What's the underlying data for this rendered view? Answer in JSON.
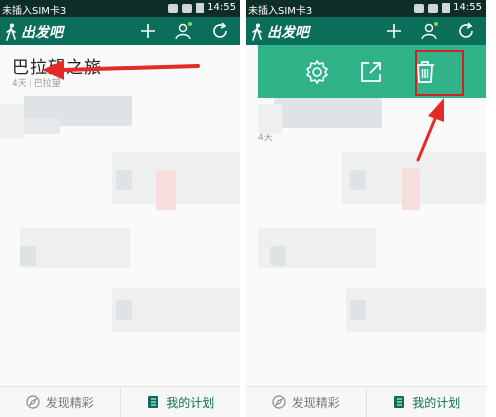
{
  "status_bar": {
    "carrier": "未插入SIM卡3",
    "time": "14:55"
  },
  "app": {
    "logo_text": "出发吧",
    "brand_color": "#0b6e5b",
    "header_icons": [
      "add-icon",
      "profile-icon",
      "sync-icon"
    ]
  },
  "trip": {
    "title": "巴拉望之旅",
    "days": "4天",
    "place": "巴拉望"
  },
  "actions": {
    "panel_color": "#30b389",
    "items": [
      "settings-icon",
      "share-icon",
      "delete-icon"
    ]
  },
  "annotation": {
    "color": "#d42020"
  },
  "bottom_tabs": {
    "discover": "发现精彩",
    "plan": "我的计划"
  },
  "right_trip_meta": "4天"
}
